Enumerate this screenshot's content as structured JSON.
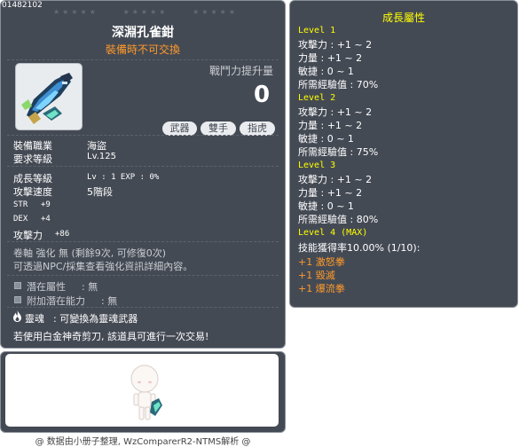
{
  "item": {
    "id": "01482102",
    "name": "深淵孔雀鉗",
    "note": "裝備時不可交換",
    "power_label": "戰鬥力提升量",
    "power_value": "0",
    "tags": [
      "武器",
      "雙手",
      "指虎"
    ]
  },
  "requirements": [
    {
      "label": "裝備職業",
      "value": "海盜"
    },
    {
      "label": "要求等級",
      "value": "Lv.125"
    }
  ],
  "growth": {
    "label": "成長等級",
    "value": "Lv : 1  EXP : 0%"
  },
  "attack_speed": {
    "label": "攻擊速度",
    "value": "5階段"
  },
  "stats": [
    {
      "label": "STR",
      "value": "+9"
    },
    {
      "label": "DEX",
      "value": "+4"
    },
    {
      "label": "攻擊力",
      "value": "+86"
    }
  ],
  "enhance": {
    "line1": "卷軸 強化 無 (剩餘9次, 可修復0次)",
    "line2": "可透過NPC/採集查看強化資訊詳細內容。"
  },
  "potential": [
    {
      "label": "潛在屬性",
      "value": ": 無"
    },
    {
      "label": "附加潛在能力",
      "value": ": 無"
    }
  ],
  "soul": {
    "label": "靈魂",
    "value": ": 可變換為靈魂武器"
  },
  "trade_note": "若使用白金神奇剪刀, 該道具可進行一次交易!",
  "footer": "@ 数据由小册子整理, WzComparerR2-NTMS解析 @",
  "growth_panel": {
    "title": "成長屬性",
    "levels": [
      {
        "name": "Level 1",
        "lines": [
          "攻擊力 : +1 ~ 2",
          "力量 : +1 ~ 2",
          "敏捷 : 0 ~ 1",
          "所需經驗值 : 70%"
        ]
      },
      {
        "name": "Level 2",
        "lines": [
          "攻擊力 : +1 ~ 2",
          "力量 : +1 ~ 2",
          "敏捷 : 0 ~ 1",
          "所需經驗值 : 75%"
        ]
      },
      {
        "name": "Level 3",
        "lines": [
          "攻擊力 : +1 ~ 2",
          "力量 : +1 ~ 2",
          "敏捷 : 0 ~ 1",
          "所需經驗值 : 80%"
        ]
      },
      {
        "name": "Level 4 (MAX)",
        "lines": [
          "技能獲得率10.00% (1/10):"
        ],
        "skills": [
          "+1 激怒拳",
          "+1 毀滅",
          "+1 爆流拳"
        ]
      }
    ]
  },
  "colors": {
    "panel_bg": "#444a54",
    "title_yellow": "#ffff00",
    "note_orange": "#ff9a2a"
  }
}
